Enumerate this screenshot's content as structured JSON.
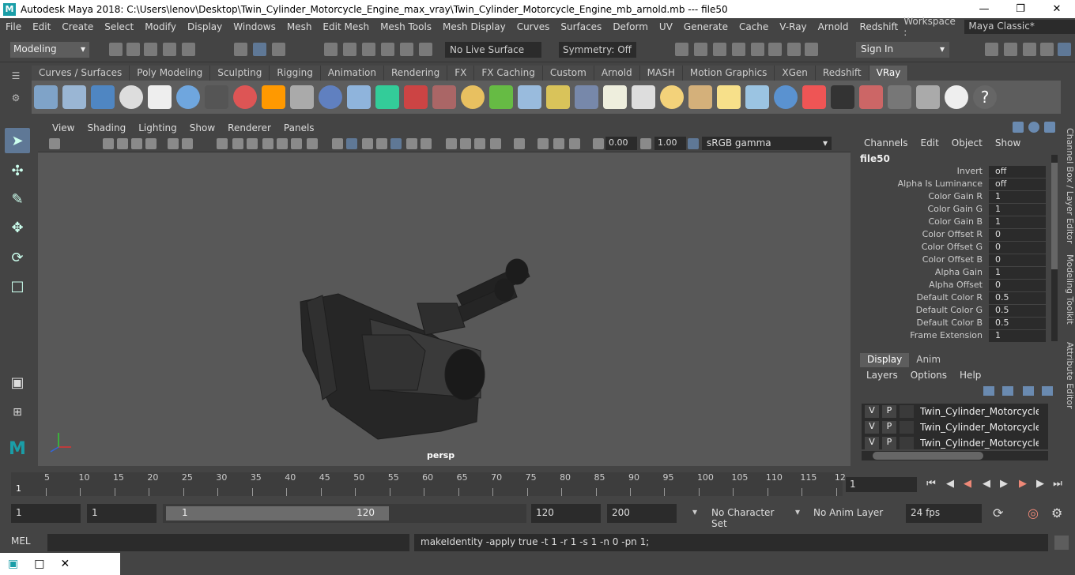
{
  "window": {
    "title": "Autodesk Maya 2018: C:\\Users\\lenov\\Desktop\\Twin_Cylinder_Motorcycle_Engine_max_vray\\Twin_Cylinder_Motorcycle_Engine_mb_arnold.mb  ---  file50",
    "logo": "M"
  },
  "menubar": {
    "items": [
      "File",
      "Edit",
      "Create",
      "Select",
      "Modify",
      "Display",
      "Windows",
      "Mesh",
      "Edit Mesh",
      "Mesh Tools",
      "Mesh Display",
      "Curves",
      "Surfaces",
      "Deform",
      "UV",
      "Generate",
      "Cache",
      "V-Ray",
      "Arnold",
      "Redshift"
    ],
    "workspace_label": "Workspace :",
    "workspace_value": "Maya Classic*"
  },
  "statusline": {
    "mode": "Modeling",
    "live_surface": "No Live Surface",
    "symmetry": "Symmetry: Off",
    "sign_in": "Sign In"
  },
  "shelf": {
    "tabs": [
      "Curves / Surfaces",
      "Poly Modeling",
      "Sculpting",
      "Rigging",
      "Animation",
      "Rendering",
      "FX",
      "FX Caching",
      "Custom",
      "Arnold",
      "MASH",
      "Motion Graphics",
      "XGen",
      "Redshift",
      "VRay"
    ],
    "active_tab": "VRay"
  },
  "viewport": {
    "menu": [
      "View",
      "Shading",
      "Lighting",
      "Show",
      "Renderer",
      "Panels"
    ],
    "exposure": "0.00",
    "gamma_value": "1.00",
    "color_space": "sRGB gamma",
    "camera_label": "persp"
  },
  "channel_box": {
    "menu": [
      "Channels",
      "Edit",
      "Object",
      "Show"
    ],
    "object_name": "file50",
    "attributes": [
      {
        "name": "Invert",
        "value": "off"
      },
      {
        "name": "Alpha Is Luminance",
        "value": "off"
      },
      {
        "name": "Color Gain R",
        "value": "1"
      },
      {
        "name": "Color Gain G",
        "value": "1"
      },
      {
        "name": "Color Gain B",
        "value": "1"
      },
      {
        "name": "Color Offset R",
        "value": "0"
      },
      {
        "name": "Color Offset G",
        "value": "0"
      },
      {
        "name": "Color Offset B",
        "value": "0"
      },
      {
        "name": "Alpha Gain",
        "value": "1"
      },
      {
        "name": "Alpha Offset",
        "value": "0"
      },
      {
        "name": "Default Color R",
        "value": "0.5"
      },
      {
        "name": "Default Color G",
        "value": "0.5"
      },
      {
        "name": "Default Color B",
        "value": "0.5"
      },
      {
        "name": "Frame Extension",
        "value": "1"
      }
    ]
  },
  "side_tabs": [
    "Channel Box / Layer Editor",
    "Modeling Toolkit",
    "Attribute Editor"
  ],
  "layer_editor": {
    "tabs": [
      "Display",
      "Anim"
    ],
    "menu": [
      "Layers",
      "Options",
      "Help"
    ],
    "rows": [
      {
        "v": "V",
        "p": "P",
        "name": "Twin_Cylinder_Motorcycle_E"
      },
      {
        "v": "V",
        "p": "P",
        "name": "Twin_Cylinder_Motorcycle_E"
      },
      {
        "v": "V",
        "p": "P",
        "name": "Twin_Cylinder_Motorcycle_E"
      }
    ]
  },
  "time_slider": {
    "ticks": [
      "5",
      "10",
      "15",
      "20",
      "25",
      "30",
      "35",
      "40",
      "45",
      "50",
      "55",
      "60",
      "65",
      "70",
      "75",
      "80",
      "85",
      "90",
      "95",
      "100",
      "105",
      "110",
      "115",
      "12"
    ],
    "start_marker": "1",
    "current_frame": "1"
  },
  "range_slider": {
    "start": "1",
    "playback_start": "1",
    "range_start_label": "1",
    "range_end_label": "120",
    "playback_end": "120",
    "end": "200",
    "character_set": "No Character Set",
    "anim_layer": "No Anim Layer",
    "fps": "24 fps"
  },
  "command_line": {
    "label": "MEL",
    "output": "makeIdentity -apply true -t 1 -r 1 -s 1 -n 0 -pn 1;"
  },
  "colors": {
    "accent_tool": "#5f7896",
    "panel_bg": "#444444",
    "viewport_bg": "#585858",
    "field_bg": "#2b2b2b"
  }
}
